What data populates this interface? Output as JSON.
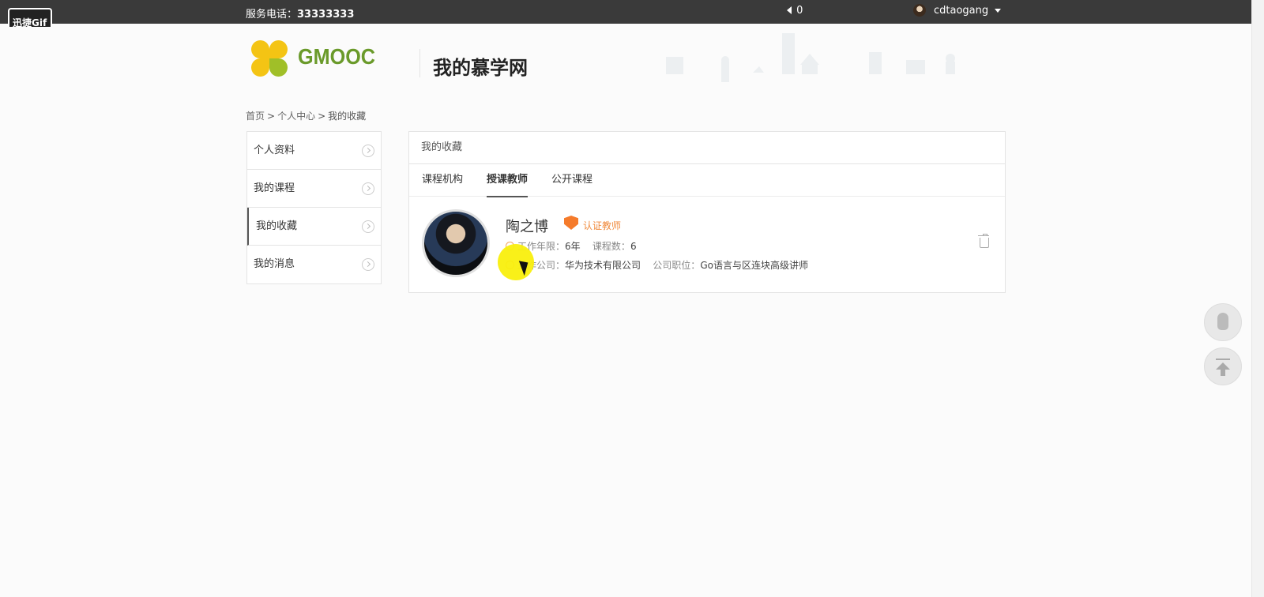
{
  "topbar": {
    "recorder_badge": "迅捷Gif",
    "phone_label": "服务电话：",
    "phone_number": "33333333",
    "message_count": "0",
    "username": "cdtaogang"
  },
  "header": {
    "logo_text": "GMOOC",
    "site_title": "我的慕学网"
  },
  "breadcrumb": {
    "home": "首页",
    "sep": ">",
    "center": "个人中心",
    "current": "我的收藏"
  },
  "sidebar": {
    "items": [
      {
        "label": "个人资料"
      },
      {
        "label": "我的课程"
      },
      {
        "label": "我的收藏"
      },
      {
        "label": "我的消息"
      }
    ]
  },
  "main": {
    "title": "我的收藏",
    "tabs": [
      {
        "label": "课程机构"
      },
      {
        "label": "授课教师"
      },
      {
        "label": "公开课程"
      }
    ],
    "teacher": {
      "name": "陶之博",
      "badge": "认证教师",
      "years_label": "工作年限：",
      "years": "6年",
      "courses_label": "课程数：",
      "courses": "6",
      "company_label": "工作公司：",
      "company": "华为技术有限公司",
      "position_label": "公司职位：",
      "position": "Go语言与区连块高级讲师"
    }
  },
  "colors": {
    "topbar": "#3a3a3a",
    "logo_green": "#6a9a2a",
    "badge_orange": "#f57b2b",
    "highlight_yellow": "#f9ef0d"
  }
}
